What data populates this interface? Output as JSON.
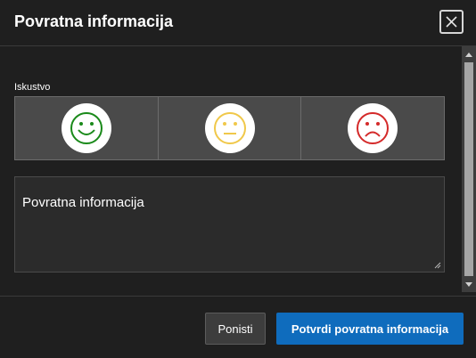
{
  "dialog": {
    "title": "Povratna informacija",
    "close_icon": "close-icon"
  },
  "experience": {
    "label": "Iskustvo",
    "options": [
      {
        "icon": "happy-face-icon",
        "color": "#1a8a1a"
      },
      {
        "icon": "neutral-face-icon",
        "color": "#f0c84a"
      },
      {
        "icon": "sad-face-icon",
        "color": "#d42a2a"
      }
    ]
  },
  "feedback": {
    "value": "Povratna informacija"
  },
  "footer": {
    "cancel_label": "Ponisti",
    "submit_label": "Potvrdi povratna informacija"
  },
  "colors": {
    "background": "#1f1f1f",
    "accent": "#0f6cbd",
    "rating_background": "#4a4a4a"
  }
}
